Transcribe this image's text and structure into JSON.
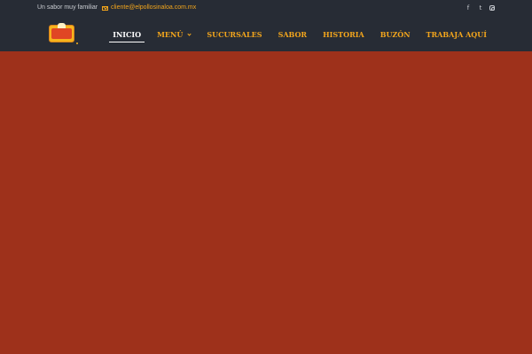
{
  "topbar": {
    "tagline": "Un sabor muy familiar",
    "email": "cliente@elpollosinaloa.com.mx",
    "social": [
      {
        "icon": "facebook-icon",
        "glyph": "f"
      },
      {
        "icon": "twitter-icon",
        "glyph": "t"
      },
      {
        "icon": "instagram-icon"
      }
    ]
  },
  "nav": {
    "items": [
      {
        "label": "INICIO",
        "active": true
      },
      {
        "label": "MENÚ",
        "dropdown": true
      },
      {
        "label": "SUCURSALES"
      },
      {
        "label": "SABOR"
      },
      {
        "label": "HISTORIA"
      },
      {
        "label": "BUZÓN"
      },
      {
        "label": "TRABAJA AQUÍ"
      }
    ]
  },
  "colors": {
    "header_bg": "#272c35",
    "accent": "#f2a51c",
    "hero_bg": "#9e311b"
  }
}
